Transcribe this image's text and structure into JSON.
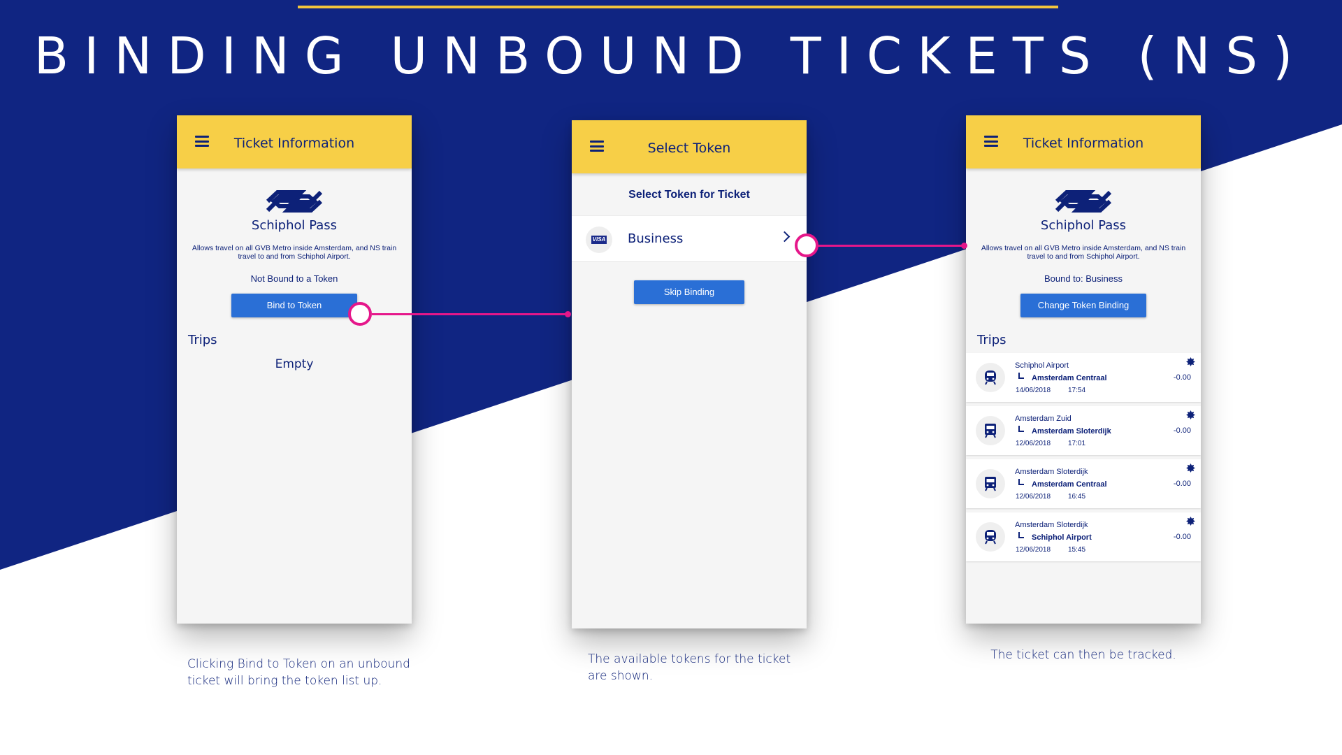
{
  "page": {
    "title": "BINDING UNBOUND TICKETS (NS)"
  },
  "colors": {
    "navy": "#0d2178",
    "yellow": "#f7cf47",
    "magenta": "#e5178a",
    "button_blue": "#2a6fd6",
    "bg_blue": "#102582"
  },
  "screen1": {
    "appbar_title": "Ticket Information",
    "pass_name": "Schiphol Pass",
    "pass_desc": "Allows travel on all GVB Metro inside Amsterdam, and NS train travel to and from Schiphol Airport.",
    "bound_status": "Not Bound to a Token",
    "button_label": "Bind to Token",
    "trips_heading": "Trips",
    "trips_empty": "Empty",
    "caption": "Clicking Bind to Token on an unbound ticket will bring the token list up."
  },
  "screen2": {
    "appbar_title": "Select Token",
    "subheading": "Select Token for Ticket",
    "token": {
      "icon": "visa-card-icon",
      "badge": "VISA",
      "label": "Business"
    },
    "skip_label": "Skip Binding",
    "caption": "The available tokens for the ticket are shown."
  },
  "screen3": {
    "appbar_title": "Ticket Information",
    "pass_name": "Schiphol Pass",
    "pass_desc": "Allows travel on all GVB Metro inside Amsterdam, and NS train travel to and from Schiphol Airport.",
    "bound_status": "Bound to: Business",
    "button_label": "Change Token Binding",
    "trips_heading": "Trips",
    "trips": [
      {
        "icon": "metro-icon",
        "from": "Schiphol Airport",
        "to": "Amsterdam Centraal",
        "date": "14/06/2018",
        "time": "17:54",
        "amount": "-0.00"
      },
      {
        "icon": "train-icon",
        "from": "Amsterdam Zuid",
        "to": "Amsterdam Sloterdijk",
        "date": "12/06/2018",
        "time": "17:01",
        "amount": "-0.00"
      },
      {
        "icon": "train-icon",
        "from": "Amsterdam Sloterdijk",
        "to": "Amsterdam Centraal",
        "date": "12/06/2018",
        "time": "16:45",
        "amount": "-0.00"
      },
      {
        "icon": "metro-icon",
        "from": "Amsterdam Sloterdijk",
        "to": "Schiphol Airport",
        "date": "12/06/2018",
        "time": "15:45",
        "amount": "-0.00"
      }
    ],
    "caption": "The ticket can then be tracked."
  }
}
